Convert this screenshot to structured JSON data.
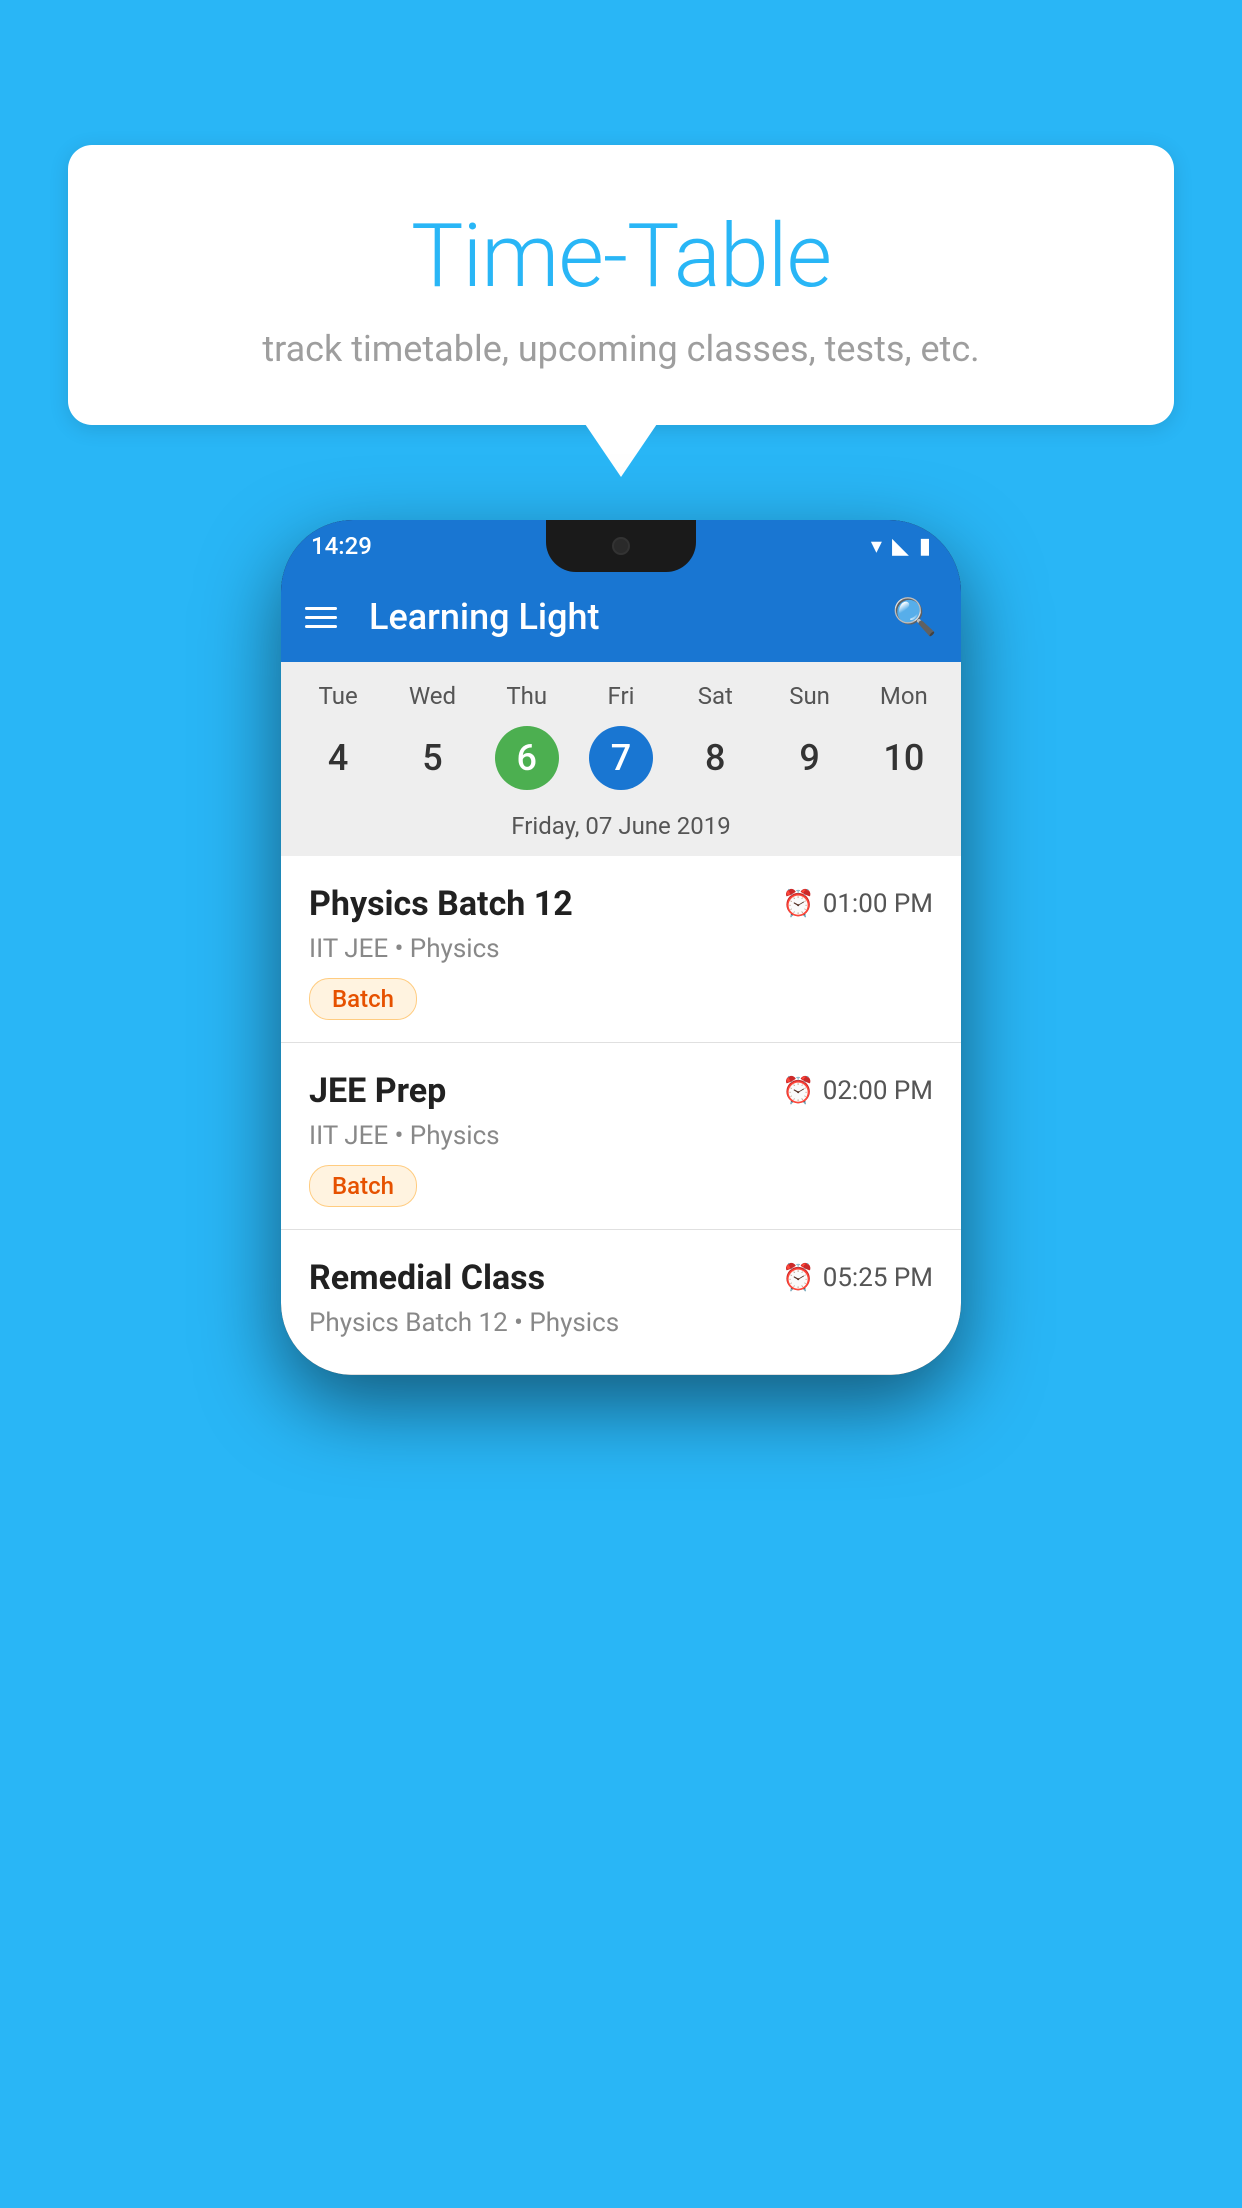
{
  "background_color": "#29B6F6",
  "speech_bubble": {
    "title": "Time-Table",
    "subtitle": "track timetable, upcoming classes, tests, etc."
  },
  "phone": {
    "status_bar": {
      "time": "14:29"
    },
    "app_bar": {
      "title": "Learning Light"
    },
    "calendar": {
      "days": [
        {
          "name": "Tue",
          "number": "4",
          "state": "normal"
        },
        {
          "name": "Wed",
          "number": "5",
          "state": "normal"
        },
        {
          "name": "Thu",
          "number": "6",
          "state": "today"
        },
        {
          "name": "Fri",
          "number": "7",
          "state": "selected"
        },
        {
          "name": "Sat",
          "number": "8",
          "state": "normal"
        },
        {
          "name": "Sun",
          "number": "9",
          "state": "normal"
        },
        {
          "name": "Mon",
          "number": "10",
          "state": "normal"
        }
      ],
      "selected_date_label": "Friday, 07 June 2019"
    },
    "schedule": [
      {
        "title": "Physics Batch 12",
        "time": "01:00 PM",
        "subtitle": "IIT JEE • Physics",
        "badge": "Batch"
      },
      {
        "title": "JEE Prep",
        "time": "02:00 PM",
        "subtitle": "IIT JEE • Physics",
        "badge": "Batch"
      },
      {
        "title": "Remedial Class",
        "time": "05:25 PM",
        "subtitle": "Physics Batch 12 • Physics",
        "badge": null
      }
    ]
  }
}
